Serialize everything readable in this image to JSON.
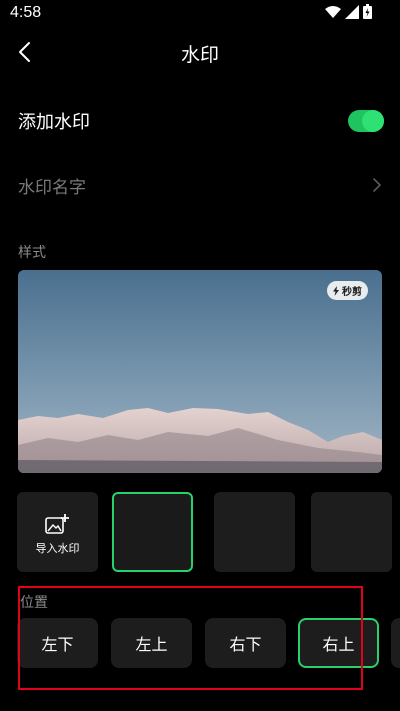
{
  "status_bar": {
    "time": "4:58",
    "icons": [
      "wifi-icon",
      "signal-icon",
      "battery-icon"
    ]
  },
  "nav": {
    "title": "水印",
    "back_icon": "chevron-left-icon"
  },
  "add_watermark": {
    "label": "添加水印",
    "enabled": true
  },
  "watermark_name": {
    "label": "水印名字",
    "icon": "chevron-right-icon"
  },
  "style_section": {
    "title": "样式",
    "preview_badge": "秒剪",
    "import_label": "导入水印",
    "thumbnails": [
      "import",
      "blank-selected",
      "blank",
      "blank"
    ]
  },
  "position_section": {
    "title": "位置",
    "options": [
      "左下",
      "左上",
      "右下",
      "右上"
    ],
    "selected": "右上"
  },
  "colors": {
    "accent": "#2ad06a",
    "background": "#000000",
    "card": "#1d1d1d",
    "annotation": "#e3001b"
  }
}
